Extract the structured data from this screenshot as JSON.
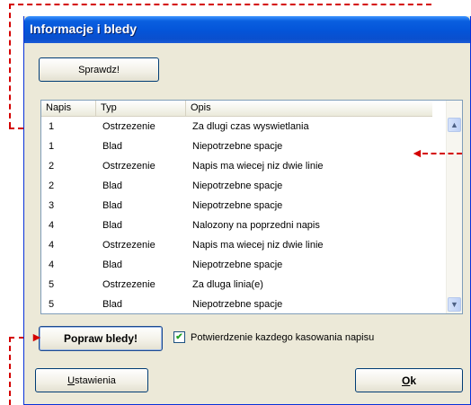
{
  "window": {
    "title": "Informacje i bledy"
  },
  "buttons": {
    "check": "Sprawdz!",
    "fix": "Popraw bledy!",
    "settings_underlined": "U",
    "settings_rest": "stawienia",
    "ok_underlined": "O",
    "ok_rest": "k"
  },
  "table": {
    "columns": [
      "Napis",
      "Typ",
      "Opis"
    ],
    "rows": [
      [
        "1",
        "Ostrzezenie",
        "Za dlugi czas wyswietlania"
      ],
      [
        "1",
        "Blad",
        "Niepotrzebne spacje"
      ],
      [
        "2",
        "Ostrzezenie",
        "Napis ma wiecej niz dwie linie"
      ],
      [
        "2",
        "Blad",
        "Niepotrzebne spacje"
      ],
      [
        "3",
        "Blad",
        "Niepotrzebne spacje"
      ],
      [
        "4",
        "Blad",
        "Nalozony na poprzedni napis"
      ],
      [
        "4",
        "Ostrzezenie",
        "Napis ma wiecej niz dwie linie"
      ],
      [
        "4",
        "Blad",
        "Niepotrzebne spacje"
      ],
      [
        "5",
        "Ostrzezenie",
        "Za dluga linia(e)"
      ],
      [
        "5",
        "Blad",
        "Niepotrzebne spacje"
      ]
    ]
  },
  "checkbox": {
    "label": "Potwierdzenie kazdego kasowania napisu",
    "checked": true
  },
  "icons": {
    "scroll_up": "chevron-up-icon",
    "scroll_down": "chevron-down-icon",
    "annotation_arrow": "red-arrow-icon"
  },
  "colors": {
    "title_bar": "#0a5fe0",
    "annotation": "#d40000",
    "dialog_bg": "#ece9d8"
  }
}
